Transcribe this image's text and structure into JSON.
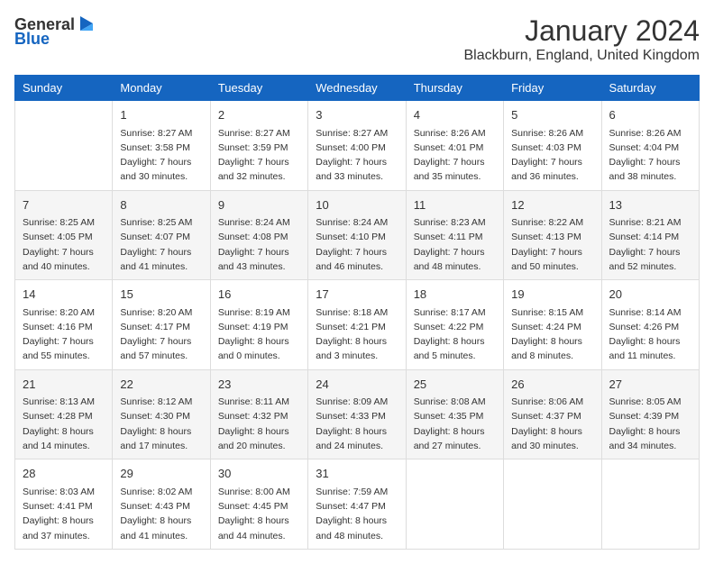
{
  "header": {
    "logo_general": "General",
    "logo_blue": "Blue",
    "month_title": "January 2024",
    "location": "Blackburn, England, United Kingdom"
  },
  "days_of_week": [
    "Sunday",
    "Monday",
    "Tuesday",
    "Wednesday",
    "Thursday",
    "Friday",
    "Saturday"
  ],
  "weeks": [
    [
      {
        "date": "",
        "sunrise": "",
        "sunset": "",
        "daylight": ""
      },
      {
        "date": "1",
        "sunrise": "Sunrise: 8:27 AM",
        "sunset": "Sunset: 3:58 PM",
        "daylight": "Daylight: 7 hours and 30 minutes."
      },
      {
        "date": "2",
        "sunrise": "Sunrise: 8:27 AM",
        "sunset": "Sunset: 3:59 PM",
        "daylight": "Daylight: 7 hours and 32 minutes."
      },
      {
        "date": "3",
        "sunrise": "Sunrise: 8:27 AM",
        "sunset": "Sunset: 4:00 PM",
        "daylight": "Daylight: 7 hours and 33 minutes."
      },
      {
        "date": "4",
        "sunrise": "Sunrise: 8:26 AM",
        "sunset": "Sunset: 4:01 PM",
        "daylight": "Daylight: 7 hours and 35 minutes."
      },
      {
        "date": "5",
        "sunrise": "Sunrise: 8:26 AM",
        "sunset": "Sunset: 4:03 PM",
        "daylight": "Daylight: 7 hours and 36 minutes."
      },
      {
        "date": "6",
        "sunrise": "Sunrise: 8:26 AM",
        "sunset": "Sunset: 4:04 PM",
        "daylight": "Daylight: 7 hours and 38 minutes."
      }
    ],
    [
      {
        "date": "7",
        "sunrise": "Sunrise: 8:25 AM",
        "sunset": "Sunset: 4:05 PM",
        "daylight": "Daylight: 7 hours and 40 minutes."
      },
      {
        "date": "8",
        "sunrise": "Sunrise: 8:25 AM",
        "sunset": "Sunset: 4:07 PM",
        "daylight": "Daylight: 7 hours and 41 minutes."
      },
      {
        "date": "9",
        "sunrise": "Sunrise: 8:24 AM",
        "sunset": "Sunset: 4:08 PM",
        "daylight": "Daylight: 7 hours and 43 minutes."
      },
      {
        "date": "10",
        "sunrise": "Sunrise: 8:24 AM",
        "sunset": "Sunset: 4:10 PM",
        "daylight": "Daylight: 7 hours and 46 minutes."
      },
      {
        "date": "11",
        "sunrise": "Sunrise: 8:23 AM",
        "sunset": "Sunset: 4:11 PM",
        "daylight": "Daylight: 7 hours and 48 minutes."
      },
      {
        "date": "12",
        "sunrise": "Sunrise: 8:22 AM",
        "sunset": "Sunset: 4:13 PM",
        "daylight": "Daylight: 7 hours and 50 minutes."
      },
      {
        "date": "13",
        "sunrise": "Sunrise: 8:21 AM",
        "sunset": "Sunset: 4:14 PM",
        "daylight": "Daylight: 7 hours and 52 minutes."
      }
    ],
    [
      {
        "date": "14",
        "sunrise": "Sunrise: 8:20 AM",
        "sunset": "Sunset: 4:16 PM",
        "daylight": "Daylight: 7 hours and 55 minutes."
      },
      {
        "date": "15",
        "sunrise": "Sunrise: 8:20 AM",
        "sunset": "Sunset: 4:17 PM",
        "daylight": "Daylight: 7 hours and 57 minutes."
      },
      {
        "date": "16",
        "sunrise": "Sunrise: 8:19 AM",
        "sunset": "Sunset: 4:19 PM",
        "daylight": "Daylight: 8 hours and 0 minutes."
      },
      {
        "date": "17",
        "sunrise": "Sunrise: 8:18 AM",
        "sunset": "Sunset: 4:21 PM",
        "daylight": "Daylight: 8 hours and 3 minutes."
      },
      {
        "date": "18",
        "sunrise": "Sunrise: 8:17 AM",
        "sunset": "Sunset: 4:22 PM",
        "daylight": "Daylight: 8 hours and 5 minutes."
      },
      {
        "date": "19",
        "sunrise": "Sunrise: 8:15 AM",
        "sunset": "Sunset: 4:24 PM",
        "daylight": "Daylight: 8 hours and 8 minutes."
      },
      {
        "date": "20",
        "sunrise": "Sunrise: 8:14 AM",
        "sunset": "Sunset: 4:26 PM",
        "daylight": "Daylight: 8 hours and 11 minutes."
      }
    ],
    [
      {
        "date": "21",
        "sunrise": "Sunrise: 8:13 AM",
        "sunset": "Sunset: 4:28 PM",
        "daylight": "Daylight: 8 hours and 14 minutes."
      },
      {
        "date": "22",
        "sunrise": "Sunrise: 8:12 AM",
        "sunset": "Sunset: 4:30 PM",
        "daylight": "Daylight: 8 hours and 17 minutes."
      },
      {
        "date": "23",
        "sunrise": "Sunrise: 8:11 AM",
        "sunset": "Sunset: 4:32 PM",
        "daylight": "Daylight: 8 hours and 20 minutes."
      },
      {
        "date": "24",
        "sunrise": "Sunrise: 8:09 AM",
        "sunset": "Sunset: 4:33 PM",
        "daylight": "Daylight: 8 hours and 24 minutes."
      },
      {
        "date": "25",
        "sunrise": "Sunrise: 8:08 AM",
        "sunset": "Sunset: 4:35 PM",
        "daylight": "Daylight: 8 hours and 27 minutes."
      },
      {
        "date": "26",
        "sunrise": "Sunrise: 8:06 AM",
        "sunset": "Sunset: 4:37 PM",
        "daylight": "Daylight: 8 hours and 30 minutes."
      },
      {
        "date": "27",
        "sunrise": "Sunrise: 8:05 AM",
        "sunset": "Sunset: 4:39 PM",
        "daylight": "Daylight: 8 hours and 34 minutes."
      }
    ],
    [
      {
        "date": "28",
        "sunrise": "Sunrise: 8:03 AM",
        "sunset": "Sunset: 4:41 PM",
        "daylight": "Daylight: 8 hours and 37 minutes."
      },
      {
        "date": "29",
        "sunrise": "Sunrise: 8:02 AM",
        "sunset": "Sunset: 4:43 PM",
        "daylight": "Daylight: 8 hours and 41 minutes."
      },
      {
        "date": "30",
        "sunrise": "Sunrise: 8:00 AM",
        "sunset": "Sunset: 4:45 PM",
        "daylight": "Daylight: 8 hours and 44 minutes."
      },
      {
        "date": "31",
        "sunrise": "Sunrise: 7:59 AM",
        "sunset": "Sunset: 4:47 PM",
        "daylight": "Daylight: 8 hours and 48 minutes."
      },
      {
        "date": "",
        "sunrise": "",
        "sunset": "",
        "daylight": ""
      },
      {
        "date": "",
        "sunrise": "",
        "sunset": "",
        "daylight": ""
      },
      {
        "date": "",
        "sunrise": "",
        "sunset": "",
        "daylight": ""
      }
    ]
  ]
}
